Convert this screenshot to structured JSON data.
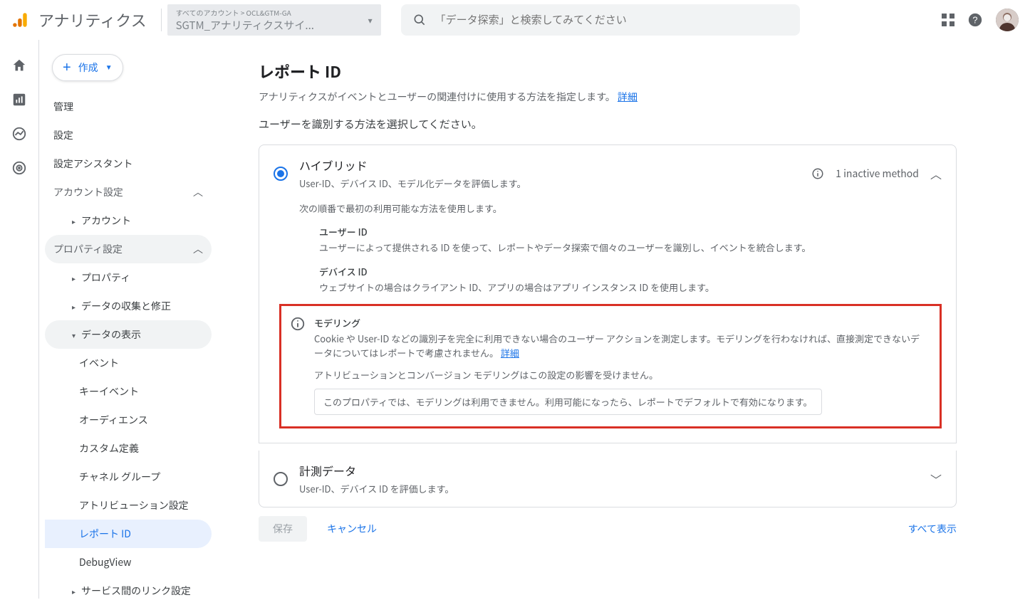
{
  "header": {
    "brand": "アナリティクス",
    "account_top": "すべてのアカウント > OCL&GTM-GA",
    "account_bot": "SGTM_アナリティクスサイ...",
    "search_placeholder": "「データ探索」と検索してみてください"
  },
  "sidebar": {
    "create": "作成",
    "admin": "管理",
    "settings": "設定",
    "assistant": "設定アシスタント",
    "account_settings": "アカウント設定",
    "account": "アカウント",
    "property_settings": "プロパティ設定",
    "property": "プロパティ",
    "data_collection": "データの収集と修正",
    "data_display": "データの表示",
    "events": "イベント",
    "key_events": "キーイベント",
    "audiences": "オーディエンス",
    "custom_def": "カスタム定義",
    "channel_groups": "チャネル グループ",
    "attribution": "アトリビューション設定",
    "report_id": "レポート ID",
    "debugview": "DebugView",
    "service_links": "サービス間のリンク設定"
  },
  "main": {
    "title": "レポート ID",
    "desc": "アナリティクスがイベントとユーザーの関連付けに使用する方法を指定します。",
    "learn": "詳細",
    "subhead": "ユーザーを識別する方法を選択してください。",
    "hybrid": {
      "title": "ハイブリッド",
      "sub": "User-ID、デバイス ID、モデル化データを評価します。",
      "inactive": "1 inactive method",
      "body_lead": "次の順番で最初の利用可能な方法を使用します。",
      "m1_title": "ユーザー ID",
      "m1_desc": "ユーザーによって提供される ID を使って、レポートやデータ探索で個々のユーザーを識別し、イベントを統合します。",
      "m2_title": "デバイス ID",
      "m2_desc": "ウェブサイトの場合はクライアント ID、アプリの場合はアプリ インスタンス ID を使用します。",
      "m3_title": "モデリング",
      "m3_desc": "Cookie や User-ID などの識別子を完全に利用できない場合のユーザー アクションを測定します。モデリングを行わなければ、直接測定できないデータについてはレポートで考慮されません。",
      "m3_link": "詳細",
      "m3_note": "アトリビューションとコンバージョン モデリングはこの設定の影響を受けません。",
      "m3_disabled": "このプロパティでは、モデリングは利用できません。利用可能になったら、レポートでデフォルトで有効になります。"
    },
    "observed": {
      "title": "計測データ",
      "sub": "User-ID、デバイス ID を評価します。"
    },
    "save": "保存",
    "cancel": "キャンセル",
    "show_all": "すべて表示"
  }
}
